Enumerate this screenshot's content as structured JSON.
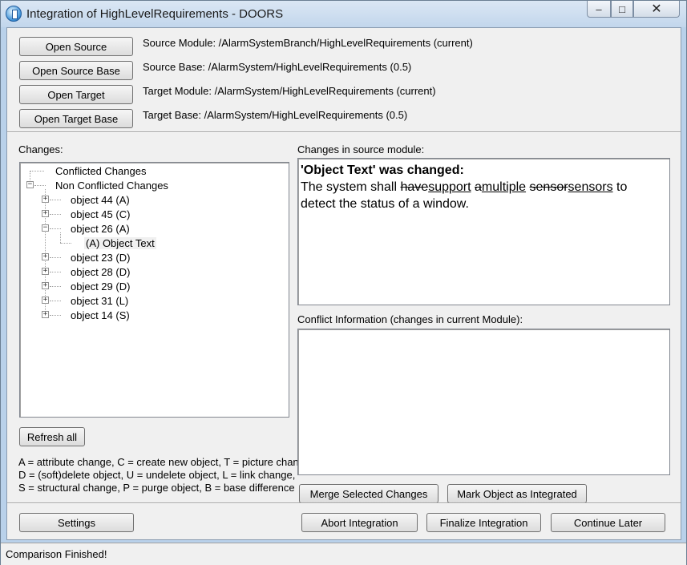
{
  "window": {
    "title": "Integration of HighLevelRequirements - DOORS",
    "min_glyph": "–",
    "max_glyph": "□",
    "close_glyph": "✕"
  },
  "top_buttons": {
    "open_source": "Open Source",
    "open_source_base": "Open Source Base",
    "open_target": "Open Target",
    "open_target_base": "Open Target Base"
  },
  "modules": {
    "source_module": "Source Module: /AlarmSystemBranch/HighLevelRequirements (current)",
    "source_base": "Source Base: /AlarmSystem/HighLevelRequirements (0.5)",
    "target_module": "Target Module: /AlarmSystem/HighLevelRequirements (current)",
    "target_base": "Target Base: /AlarmSystem/HighLevelRequirements (0.5)"
  },
  "changes": {
    "label": "Changes:",
    "tree": {
      "conflicted": "Conflicted Changes",
      "non_conflicted": "Non Conflicted Changes",
      "objects": [
        {
          "label": "object 44 (A)",
          "expanded": false
        },
        {
          "label": "object 45 (C)",
          "expanded": false
        },
        {
          "label": "object 26 (A)",
          "expanded": true,
          "child": "(A) Object Text"
        },
        {
          "label": "object 23 (D)",
          "expanded": false
        },
        {
          "label": "object 28 (D)",
          "expanded": false
        },
        {
          "label": "object 29 (D)",
          "expanded": false
        },
        {
          "label": "object 31 (L)",
          "expanded": false
        },
        {
          "label": "object 14 (S)",
          "expanded": false
        }
      ]
    },
    "refresh_button": "Refresh all"
  },
  "source_changes": {
    "label": "Changes in source module:",
    "heading": "'Object Text' was changed:",
    "segments": {
      "s1": "The system shall ",
      "del1": "have",
      "ins1": "support",
      "s2": " ",
      "del2": "a",
      "ins2": "multiple",
      "s3": " ",
      "del3": "sensor",
      "ins3": "sensors",
      "s4": " to detect the status of a window."
    }
  },
  "conflict": {
    "label": "Conflict Information (changes in current Module):",
    "content": ""
  },
  "legend": {
    "line1": "A = attribute change, C = create new object, T = picture change,",
    "line2": "D = (soft)delete object, U = undelete object, L = link change,",
    "line3": "S = structural change, P = purge object, B = base difference"
  },
  "actions": {
    "merge_selected": "Merge Selected Changes",
    "mark_integrated": "Mark Object as Integrated",
    "settings": "Settings",
    "abort": "Abort Integration",
    "finalize": "Finalize Integration",
    "continue_later": "Continue Later"
  },
  "status": {
    "text": "Comparison Finished!"
  }
}
